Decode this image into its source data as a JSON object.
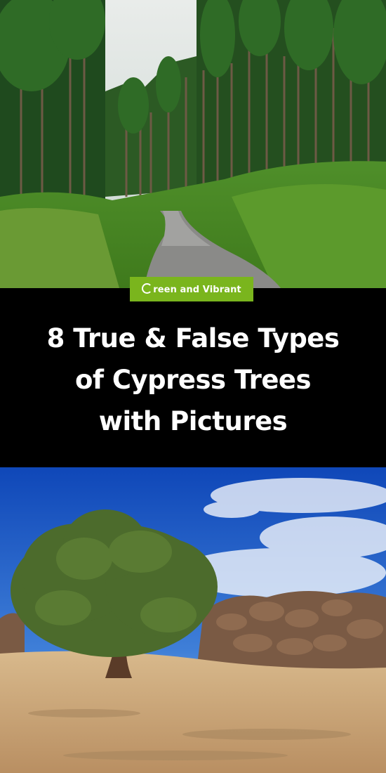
{
  "brand": {
    "name": "Green and Vibrant",
    "display": "reen and Vibrant",
    "color": "#7ab51d"
  },
  "title": {
    "lines": [
      "8 True & False Types",
      "of Cypress Trees",
      "with Pictures"
    ]
  },
  "images": {
    "top": "forest-road-with-tall-cypress-trees",
    "bottom": "lone-cypress-tree-in-desert"
  }
}
